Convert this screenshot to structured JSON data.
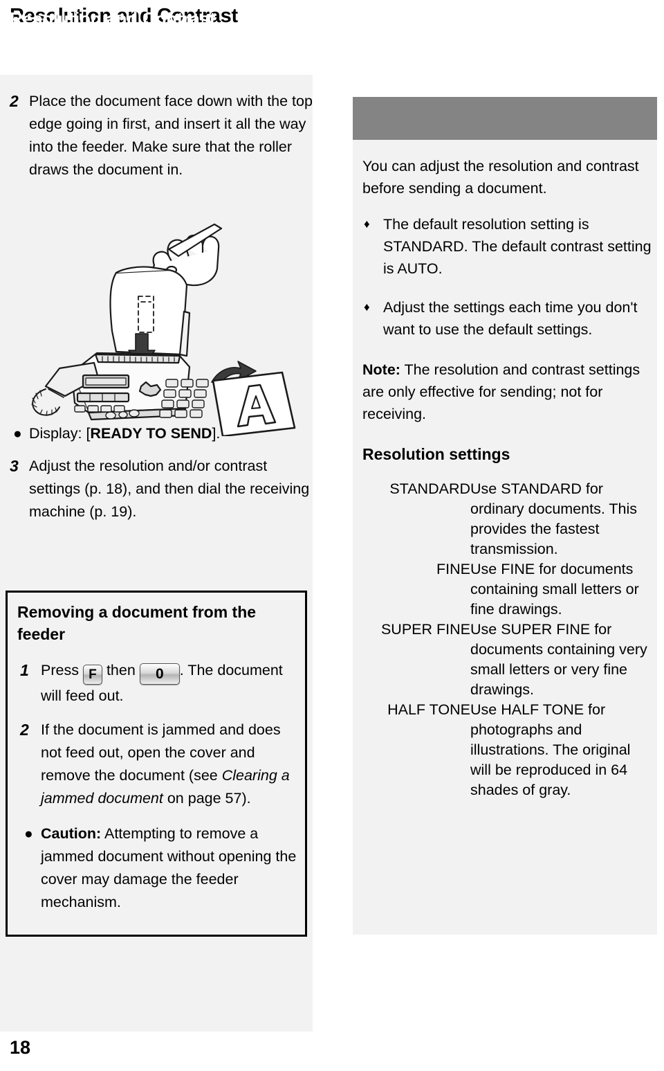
{
  "page": {
    "heading": "Resolution and Contrast",
    "number": "18"
  },
  "left_column": {
    "step2": {
      "number": "2",
      "text": "Place the document face down with the top edge going in first, and insert it all the way into the feeder. Make sure that the roller draws the document in."
    },
    "illustration": {
      "name": "fax-machine-feeding-document",
      "sheet_letter": "A"
    },
    "display_note": {
      "bullet": "●",
      "prefix": "Display: [",
      "bold_text": "READY TO SEND",
      "suffix": "]."
    },
    "step3": {
      "number": "3",
      "text": "Adjust the resolution and/or contrast settings (p. 18), and then dial the receiving machine (p. 19)."
    },
    "removing_box": {
      "title": "Removing a document from the feeder",
      "step1": {
        "number": "1",
        "text_before_key1": "Press",
        "key1": "F",
        "text_between_keys": "then",
        "key2": "0",
        "text_after_keys": ". The document will feed out."
      },
      "step2": {
        "number": "2",
        "text_part1": "If the document is jammed and does not feed out, open the cover and remove the document (see ",
        "italic_text": "Clearing a jammed document",
        "text_part2": " on page 57)."
      },
      "caution": {
        "bullet": "●",
        "label": "Caution:",
        "text": " Attempting to remove a jammed document without opening the cover may damage the feeder mechanism."
      }
    }
  },
  "right_column": {
    "header_title": "Resolution and Contrast",
    "intro": "You can adjust the resolution and contrast before sending a document.",
    "bullets": [
      {
        "marker": "♦",
        "text": "The default resolution setting is STANDARD. The default contrast setting is AUTO."
      },
      {
        "marker": "♦",
        "text": "Adjust the settings each time you don't want to use the default settings."
      }
    ],
    "note": {
      "label": "Note:",
      "text": " The resolution and contrast settings are only effective for sending; not for receiving."
    },
    "settings_heading": "Resolution settings",
    "settings_table": {
      "rows": [
        {
          "name": "STANDARD",
          "description": "Use STANDARD for ordinary documents. This provides the fastest transmission."
        },
        {
          "name": "FINE",
          "description": "Use FINE for documents containing small letters or fine drawings."
        },
        {
          "name": "SUPER FINE",
          "description": "Use SUPER FINE for documents containing very small letters or very fine drawings."
        },
        {
          "name": "HALF TONE",
          "description": "Use HALF TONE for photographs and illustrations. The original will be reproduced in 64 shades of gray."
        }
      ]
    }
  },
  "colors": {
    "panel_background": "#f2f2f2",
    "header_bar": "#848484",
    "header_text": "#ffffff",
    "body_text": "#000000"
  }
}
